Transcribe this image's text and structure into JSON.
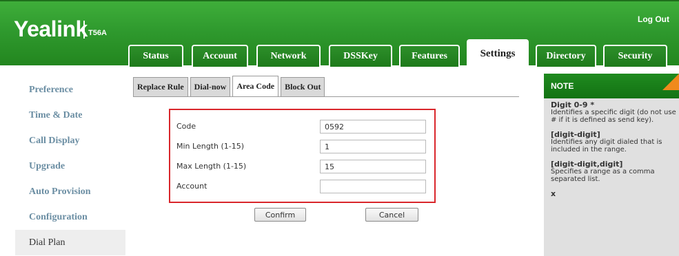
{
  "header": {
    "brand": "Yealink",
    "model": "T56A",
    "logout": "Log Out",
    "tabs": [
      {
        "label": "Status"
      },
      {
        "label": "Account"
      },
      {
        "label": "Network"
      },
      {
        "label": "DSSKey"
      },
      {
        "label": "Features"
      },
      {
        "label": "Settings",
        "active": true
      },
      {
        "label": "Directory"
      },
      {
        "label": "Security"
      }
    ]
  },
  "sidebar": {
    "items": [
      {
        "label": "Preference"
      },
      {
        "label": "Time & Date"
      },
      {
        "label": "Call Display"
      },
      {
        "label": "Upgrade"
      },
      {
        "label": "Auto Provision"
      },
      {
        "label": "Configuration"
      },
      {
        "label": "Dial Plan",
        "active": true
      }
    ]
  },
  "subtabs": [
    {
      "label": "Replace Rule"
    },
    {
      "label": "Dial-now"
    },
    {
      "label": "Area Code",
      "active": true
    },
    {
      "label": "Block Out"
    }
  ],
  "form": {
    "fields": [
      {
        "label": "Code",
        "value": "0592"
      },
      {
        "label": "Min Length (1-15)",
        "value": "1"
      },
      {
        "label": "Max Length (1-15)",
        "value": "15"
      },
      {
        "label": "Account",
        "value": ""
      }
    ],
    "confirm": "Confirm",
    "cancel": "Cancel"
  },
  "note": {
    "title": "NOTE",
    "entries": [
      {
        "term": "Digit 0-9 *",
        "desc": "Identifies a specific digit (do not use # if it is defined as send key)."
      },
      {
        "term": "[digit-digit]",
        "desc": "Identifies any digit dialed that is included in the range."
      },
      {
        "term": "[digit-digit,digit]",
        "desc": "Specifies a range as a comma separated list."
      },
      {
        "term": "x",
        "desc": ""
      }
    ]
  },
  "colors": {
    "brand_green": "#2f9a2e",
    "highlight_red": "#d9262b",
    "note_corner": "#f08a1c",
    "sidebar_text": "#6b8ea3"
  }
}
